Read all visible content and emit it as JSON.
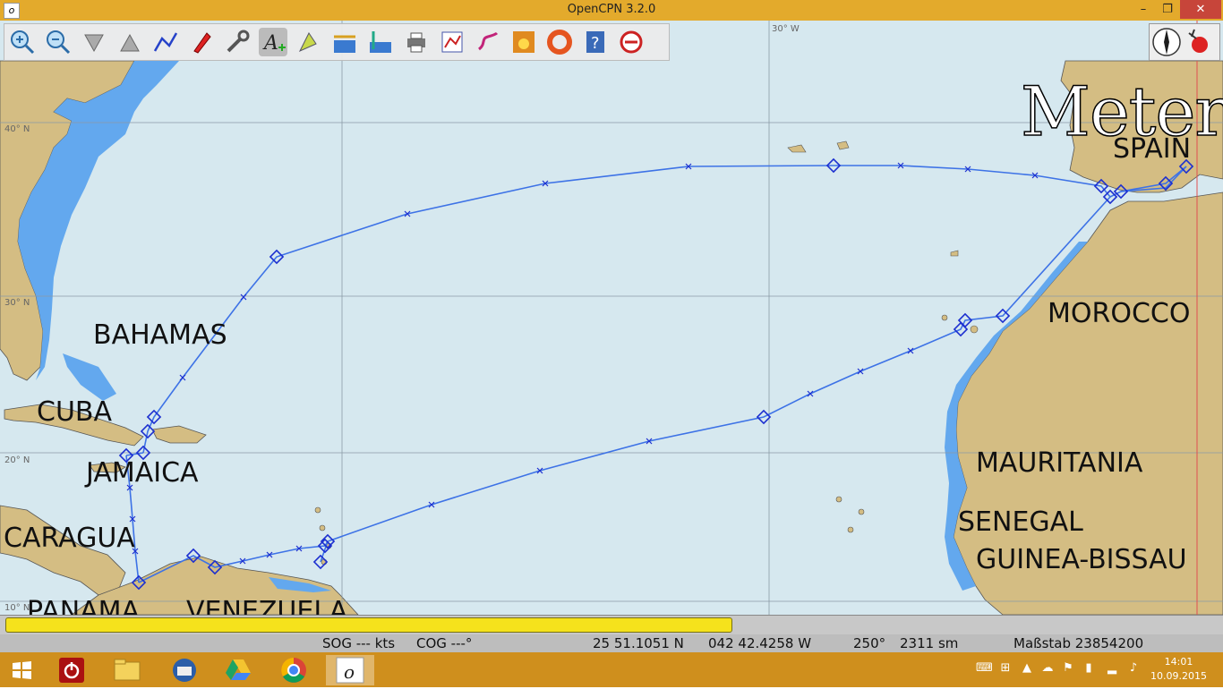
{
  "window": {
    "title": "OpenCPN 3.2.0",
    "app_icon": "opencpn-icon",
    "minimize": "–",
    "maximize": "❐",
    "close": "✕"
  },
  "toolbar": {
    "buttons": [
      "zoom-in-icon",
      "zoom-out-icon",
      "scale-down-icon",
      "scale-up-icon",
      "route-icon",
      "ship-icon",
      "settings-icon",
      "text-icon",
      "current-icon",
      "tide-icon",
      "tide-graph-icon",
      "print-icon",
      "route-manager-icon",
      "track-icon",
      "day-night-icon",
      "man-overboard-icon",
      "help-icon",
      "ais-icon"
    ]
  },
  "chart": {
    "depth_unit_watermark": "Meter",
    "grid_labels": {
      "lon_30w": "30° W",
      "lat_40n": "40° N",
      "lat_30n": "30° N",
      "lat_20n": "20° N",
      "lat_10n": "10° N"
    },
    "country_labels": {
      "spain": "SPAIN",
      "bahamas": "BAHAMAS",
      "cuba": "CUBA",
      "jamaica": "JAMAICA",
      "nicaragua": "CARAGUA",
      "panama": "PANAMA",
      "venezuela": "VENEZUELA",
      "morocco": "MOROCCO",
      "mauritania": "MAURITANIA",
      "senegal": "SENEGAL",
      "guinea_bissau": "GUINEA-BISSAU"
    },
    "colors": {
      "sea": "#d6e8ef",
      "shallow": "#63a8ee",
      "land": "#d4bd83",
      "route": "#3d72e6",
      "grid": "#8a9aa6",
      "waypoint": "#1c2fd0"
    }
  },
  "progress": {
    "fraction": 0.6
  },
  "status": {
    "sog": "SOG --- kts",
    "cog": "COG ---°",
    "lat": "25 51.1051 N",
    "lon": "042 42.4258 W",
    "bearing": "250°",
    "distance": "2311 sm",
    "scale": "Maßstab 23854200"
  },
  "taskbar": {
    "apps": [
      "windows-start-icon",
      "shutdown-icon",
      "file-explorer-icon",
      "thunderbird-icon",
      "google-drive-icon",
      "chrome-icon",
      "opencpn-task-icon"
    ],
    "clock_time": "14:01",
    "clock_date": "10.09.2015"
  }
}
